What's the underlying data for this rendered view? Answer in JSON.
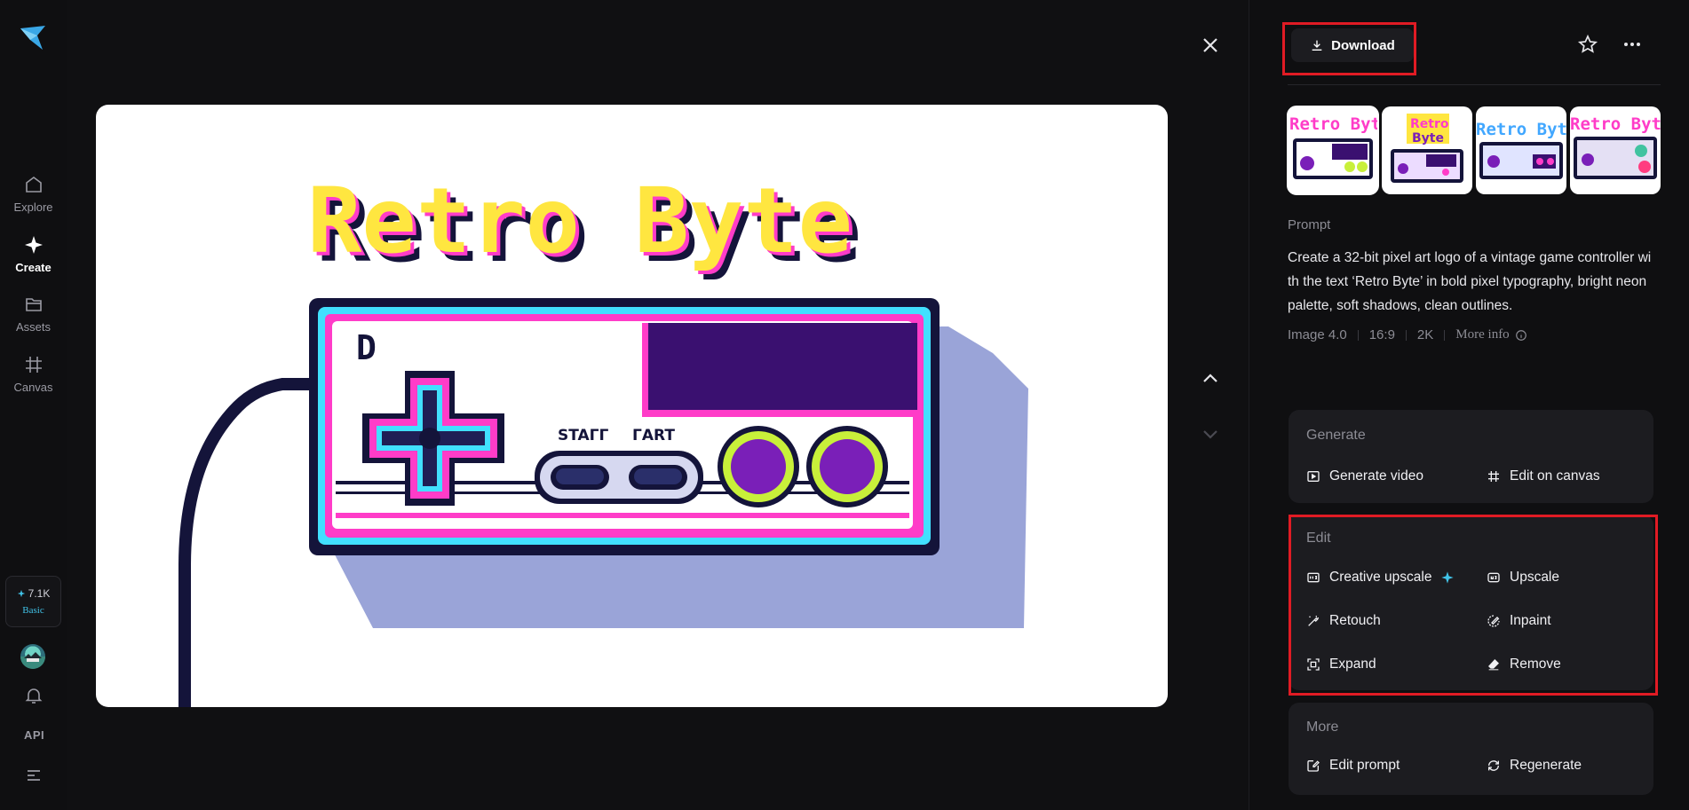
{
  "sidebar": {
    "items": [
      {
        "label": "Explore",
        "icon": "home-icon"
      },
      {
        "label": "Create",
        "icon": "sparkle-icon"
      },
      {
        "label": "Assets",
        "icon": "folder-icon"
      },
      {
        "label": "Canvas",
        "icon": "canvas-icon"
      }
    ],
    "credits": {
      "amount": "7.1K",
      "plan": "Basic"
    },
    "api_label": "API"
  },
  "header": {
    "download_label": "Download"
  },
  "image": {
    "title_text": "Retro Byte",
    "controller_letter": "D",
    "start_label_left": "STAΓΓ",
    "start_label_right": "ΓART"
  },
  "thumbnails": [
    {
      "text": "Retro Byte",
      "selected": true
    },
    {
      "text": "Retro Byte",
      "selected": false
    },
    {
      "text": "Retro Byte",
      "selected": false
    },
    {
      "text": "Retro Byte",
      "selected": false
    }
  ],
  "prompt": {
    "label": "Prompt",
    "text": "Create a 32-bit pixel art logo of a vintage game controller with the text ‘Retro Byte’ in bold pixel typography, bright neon palette, soft shadows, clean outlines.",
    "model": "Image 4.0",
    "ratio": "16:9",
    "resolution": "2K",
    "more_info": "More info"
  },
  "generate": {
    "title": "Generate",
    "generate_video": "Generate video",
    "edit_on_canvas": "Edit on canvas"
  },
  "edit": {
    "title": "Edit",
    "creative_upscale": "Creative upscale",
    "upscale": "Upscale",
    "retouch": "Retouch",
    "inpaint": "Inpaint",
    "expand": "Expand",
    "remove": "Remove"
  },
  "more": {
    "title": "More",
    "edit_prompt": "Edit prompt",
    "regenerate": "Regenerate"
  },
  "colors": {
    "accent": "#41c3e8",
    "highlight": "#e01b24",
    "panel": "#1c1c20"
  }
}
